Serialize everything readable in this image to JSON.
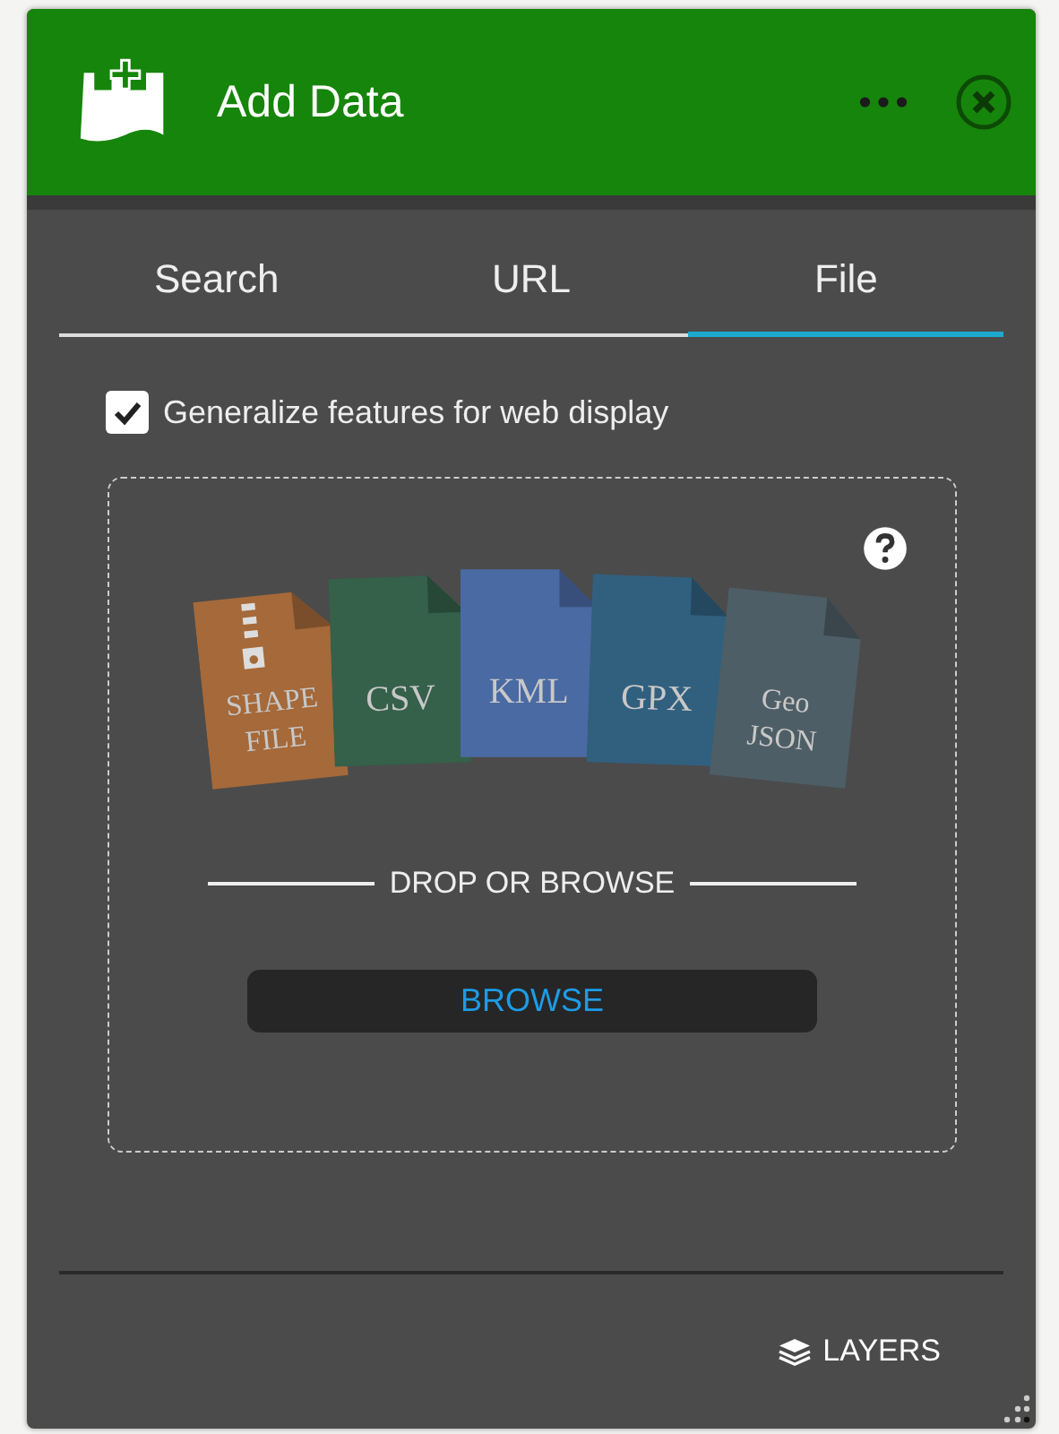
{
  "window": {
    "title": "Add Data"
  },
  "tabs": [
    {
      "label": "Search",
      "selected": false
    },
    {
      "label": "URL",
      "selected": false
    },
    {
      "label": "File",
      "selected": true
    }
  ],
  "option": {
    "label": "Generalize features for web display",
    "checked": true
  },
  "file_types": [
    {
      "lines": [
        "SHAPE",
        "FILE"
      ],
      "color": "#a5693a",
      "zipped": true
    },
    {
      "lines": [
        "CSV"
      ],
      "color": "#35604a",
      "zipped": false
    },
    {
      "lines": [
        "KML"
      ],
      "color": "#4a6aa3",
      "zipped": false
    },
    {
      "lines": [
        "GPX"
      ],
      "color": "#31607f",
      "zipped": false
    },
    {
      "lines": [
        "Geo",
        "JSON"
      ],
      "color": "#4e5e66",
      "zipped": false
    }
  ],
  "drop_label": "DROP OR BROWSE",
  "browse_button": "BROWSE",
  "footer_link": "LAYERS"
}
